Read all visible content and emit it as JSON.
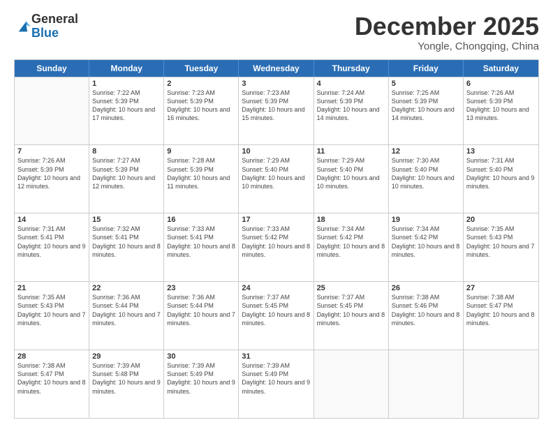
{
  "logo": {
    "general": "General",
    "blue": "Blue"
  },
  "title": "December 2025",
  "subtitle": "Yongle, Chongqing, China",
  "header_days": [
    "Sunday",
    "Monday",
    "Tuesday",
    "Wednesday",
    "Thursday",
    "Friday",
    "Saturday"
  ],
  "weeks": [
    [
      {
        "day": "",
        "info": ""
      },
      {
        "day": "1",
        "info": "Sunrise: 7:22 AM\nSunset: 5:39 PM\nDaylight: 10 hours and 17 minutes."
      },
      {
        "day": "2",
        "info": "Sunrise: 7:23 AM\nSunset: 5:39 PM\nDaylight: 10 hours and 16 minutes."
      },
      {
        "day": "3",
        "info": "Sunrise: 7:23 AM\nSunset: 5:39 PM\nDaylight: 10 hours and 15 minutes."
      },
      {
        "day": "4",
        "info": "Sunrise: 7:24 AM\nSunset: 5:39 PM\nDaylight: 10 hours and 14 minutes."
      },
      {
        "day": "5",
        "info": "Sunrise: 7:25 AM\nSunset: 5:39 PM\nDaylight: 10 hours and 14 minutes."
      },
      {
        "day": "6",
        "info": "Sunrise: 7:26 AM\nSunset: 5:39 PM\nDaylight: 10 hours and 13 minutes."
      }
    ],
    [
      {
        "day": "7",
        "info": "Sunrise: 7:26 AM\nSunset: 5:39 PM\nDaylight: 10 hours and 12 minutes."
      },
      {
        "day": "8",
        "info": "Sunrise: 7:27 AM\nSunset: 5:39 PM\nDaylight: 10 hours and 12 minutes."
      },
      {
        "day": "9",
        "info": "Sunrise: 7:28 AM\nSunset: 5:39 PM\nDaylight: 10 hours and 11 minutes."
      },
      {
        "day": "10",
        "info": "Sunrise: 7:29 AM\nSunset: 5:40 PM\nDaylight: 10 hours and 10 minutes."
      },
      {
        "day": "11",
        "info": "Sunrise: 7:29 AM\nSunset: 5:40 PM\nDaylight: 10 hours and 10 minutes."
      },
      {
        "day": "12",
        "info": "Sunrise: 7:30 AM\nSunset: 5:40 PM\nDaylight: 10 hours and 10 minutes."
      },
      {
        "day": "13",
        "info": "Sunrise: 7:31 AM\nSunset: 5:40 PM\nDaylight: 10 hours and 9 minutes."
      }
    ],
    [
      {
        "day": "14",
        "info": "Sunrise: 7:31 AM\nSunset: 5:41 PM\nDaylight: 10 hours and 9 minutes."
      },
      {
        "day": "15",
        "info": "Sunrise: 7:32 AM\nSunset: 5:41 PM\nDaylight: 10 hours and 8 minutes."
      },
      {
        "day": "16",
        "info": "Sunrise: 7:33 AM\nSunset: 5:41 PM\nDaylight: 10 hours and 8 minutes."
      },
      {
        "day": "17",
        "info": "Sunrise: 7:33 AM\nSunset: 5:42 PM\nDaylight: 10 hours and 8 minutes."
      },
      {
        "day": "18",
        "info": "Sunrise: 7:34 AM\nSunset: 5:42 PM\nDaylight: 10 hours and 8 minutes."
      },
      {
        "day": "19",
        "info": "Sunrise: 7:34 AM\nSunset: 5:42 PM\nDaylight: 10 hours and 8 minutes."
      },
      {
        "day": "20",
        "info": "Sunrise: 7:35 AM\nSunset: 5:43 PM\nDaylight: 10 hours and 7 minutes."
      }
    ],
    [
      {
        "day": "21",
        "info": "Sunrise: 7:35 AM\nSunset: 5:43 PM\nDaylight: 10 hours and 7 minutes."
      },
      {
        "day": "22",
        "info": "Sunrise: 7:36 AM\nSunset: 5:44 PM\nDaylight: 10 hours and 7 minutes."
      },
      {
        "day": "23",
        "info": "Sunrise: 7:36 AM\nSunset: 5:44 PM\nDaylight: 10 hours and 7 minutes."
      },
      {
        "day": "24",
        "info": "Sunrise: 7:37 AM\nSunset: 5:45 PM\nDaylight: 10 hours and 8 minutes."
      },
      {
        "day": "25",
        "info": "Sunrise: 7:37 AM\nSunset: 5:45 PM\nDaylight: 10 hours and 8 minutes."
      },
      {
        "day": "26",
        "info": "Sunrise: 7:38 AM\nSunset: 5:46 PM\nDaylight: 10 hours and 8 minutes."
      },
      {
        "day": "27",
        "info": "Sunrise: 7:38 AM\nSunset: 5:47 PM\nDaylight: 10 hours and 8 minutes."
      }
    ],
    [
      {
        "day": "28",
        "info": "Sunrise: 7:38 AM\nSunset: 5:47 PM\nDaylight: 10 hours and 8 minutes."
      },
      {
        "day": "29",
        "info": "Sunrise: 7:39 AM\nSunset: 5:48 PM\nDaylight: 10 hours and 9 minutes."
      },
      {
        "day": "30",
        "info": "Sunrise: 7:39 AM\nSunset: 5:49 PM\nDaylight: 10 hours and 9 minutes."
      },
      {
        "day": "31",
        "info": "Sunrise: 7:39 AM\nSunset: 5:49 PM\nDaylight: 10 hours and 9 minutes."
      },
      {
        "day": "",
        "info": ""
      },
      {
        "day": "",
        "info": ""
      },
      {
        "day": "",
        "info": ""
      }
    ]
  ]
}
